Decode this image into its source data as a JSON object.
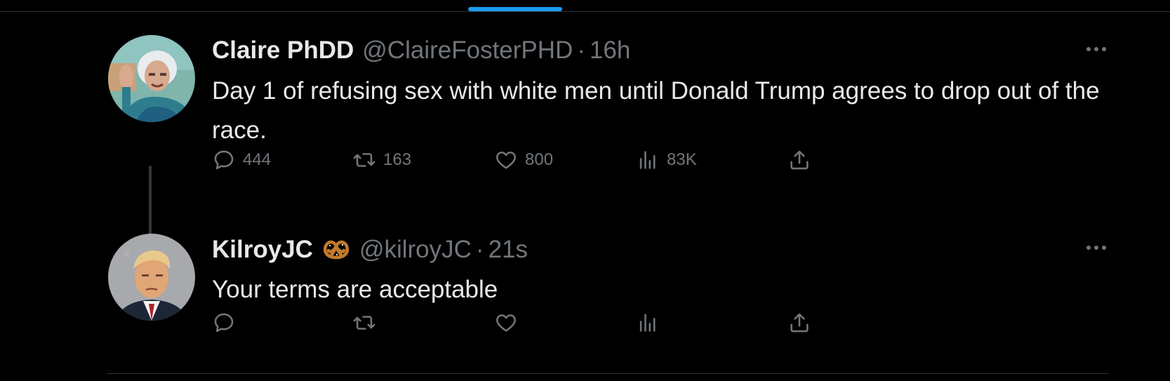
{
  "tweets": [
    {
      "display_name": "Claire PhDD",
      "handle": "@ClaireFosterPHD",
      "separator": "·",
      "time": "16h",
      "text": "Day 1 of refusing sex with white men until Donald Trump agrees to drop out of the race.",
      "stats": {
        "replies": "444",
        "retweets": "163",
        "likes": "800",
        "views": "83K"
      },
      "avatar_icon": "elderly-woman-waving-avatar"
    },
    {
      "display_name": "KilroyJC",
      "badge_icon": "pretzel-emoji",
      "handle": "@kilroyJC",
      "separator": "·",
      "time": "21s",
      "text": "Your terms are acceptable",
      "stats": {
        "replies": "",
        "retweets": "",
        "likes": "",
        "views": ""
      },
      "avatar_icon": "mugshot-avatar"
    }
  ],
  "colors": {
    "background": "#000000",
    "text_primary": "#e7e9ea",
    "text_secondary": "#71767b",
    "accent": "#1d9bf0",
    "divider": "#2f3336"
  },
  "icons": {
    "more": "more-horizontal-icon",
    "reply": "reply-icon",
    "retweet": "retweet-icon",
    "like": "heart-icon",
    "views": "views-chart-icon",
    "share": "share-upload-icon"
  }
}
